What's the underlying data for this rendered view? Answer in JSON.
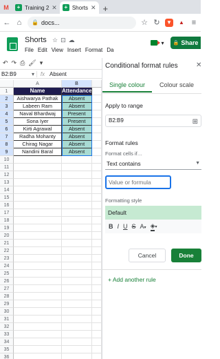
{
  "browser": {
    "tabs": [
      {
        "label": "",
        "icon": "gmail-icon"
      },
      {
        "label": "Training 2",
        "icon": "sheets-icon"
      },
      {
        "label": "Shorts",
        "icon": "sheets-icon",
        "active": true
      }
    ],
    "new_tab": "+",
    "url": "docs..."
  },
  "app": {
    "title": "Shorts",
    "menu": [
      "File",
      "Edit",
      "View",
      "Insert",
      "Format",
      "Da"
    ],
    "share_label": "Share"
  },
  "formula": {
    "cell_ref": "B2:B9",
    "fx": "fx",
    "value": "Absent"
  },
  "sheet": {
    "columns": [
      "A",
      "B"
    ],
    "row_numbers": [
      "1",
      "2",
      "3",
      "4",
      "5",
      "6",
      "7",
      "8",
      "9",
      "10",
      "11",
      "12",
      "13",
      "14",
      "15",
      "16",
      "17",
      "18",
      "19",
      "20",
      "21",
      "22",
      "23",
      "24",
      "25",
      "26",
      "27",
      "28",
      "29",
      "30",
      "31",
      "32",
      "33",
      "34",
      "35",
      "36"
    ],
    "headers": [
      "Name",
      "Attendance"
    ],
    "rows": [
      [
        "Aishwarya Pathak",
        "Absent"
      ],
      [
        "Labeen Ram",
        "Absent"
      ],
      [
        "Naval Bhardwaj",
        "Present"
      ],
      [
        "Sona Iyer",
        "Present"
      ],
      [
        "Kirti Agrawal",
        "Absent"
      ],
      [
        "Radha Mohanty",
        "Absent"
      ],
      [
        "Chirag Nagar",
        "Absent"
      ],
      [
        "Nandini Baral",
        "Absent"
      ]
    ],
    "header_color": "#1f1c4f",
    "highlight_color": "#a8dbd3"
  },
  "panel": {
    "title": "Conditional format rules",
    "tabs": [
      "Single colour",
      "Colour scale"
    ],
    "apply_label": "Apply to range",
    "range": "B2:B9",
    "rules_label": "Format rules",
    "cells_if_label": "Format cells if…",
    "condition": "Text contains",
    "value_placeholder": "Value or formula",
    "style_label": "Formatting style",
    "style_default": "Default",
    "tools": [
      "B",
      "I",
      "U",
      "S",
      "A",
      "fill"
    ],
    "cancel_label": "Cancel",
    "done_label": "Done",
    "add_rule_label": "+ Add another rule",
    "accent_color": "#188038",
    "style_preview_color": "#c6ead2"
  }
}
